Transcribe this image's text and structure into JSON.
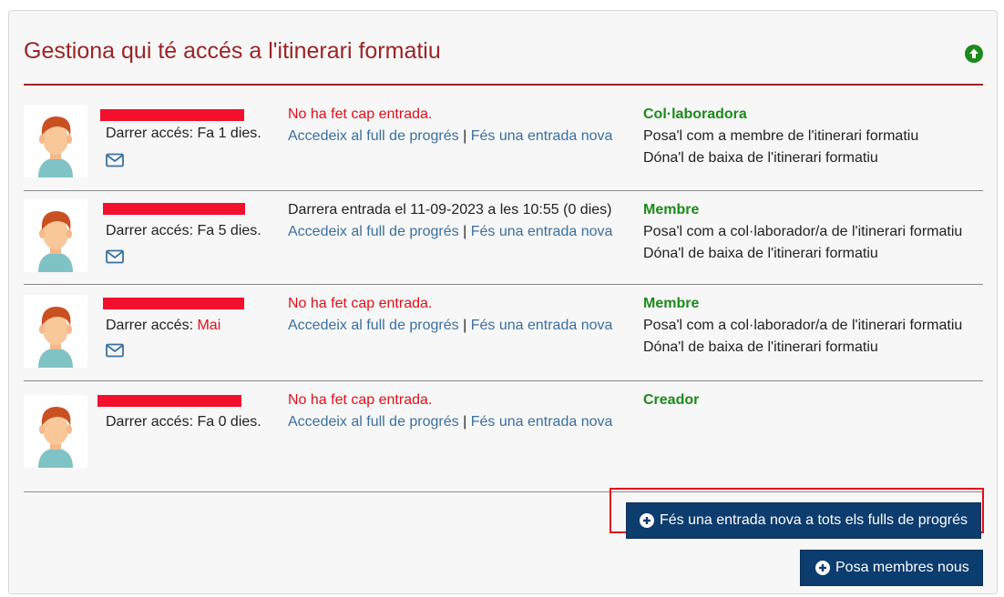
{
  "header": {
    "title": "Gestiona qui té accés a l'itinerari formatiu",
    "collapse_icon": "arrow-up-circle-icon"
  },
  "members": [
    {
      "access_label": "Darrer accés: ",
      "access_value": "Fa 1 dies.",
      "entry_status": "No ha fet cap entrada.",
      "progress_link": "Accedeix al full de progrés",
      "separator": "|",
      "new_entry_link": "Fés una entrada nova",
      "role": "Col·laboradora",
      "actions": [
        "Posa'l com a membre de l'itinerari formatiu",
        "Dóna'l de baixa de l'itinerari formatiu"
      ]
    },
    {
      "access_label": "Darrer accés: ",
      "access_value": "Fa 5 dies.",
      "entry_status": "Darrera entrada el 11-09-2023 a les 10:55 (0 dies)",
      "progress_link": "Accedeix al full de progrés",
      "separator": "|",
      "new_entry_link": "Fés una entrada nova",
      "role": "Membre",
      "actions": [
        "Posa'l com a col·laborador/a de l'itinerari formatiu",
        "Dóna'l de baixa de l'itinerari formatiu"
      ]
    },
    {
      "access_label": "Darrer accés: ",
      "access_value": "Mai",
      "entry_status": "No ha fet cap entrada.",
      "progress_link": "Accedeix al full de progrés",
      "separator": "|",
      "new_entry_link": "Fés una entrada nova",
      "role": "Membre",
      "actions": [
        "Posa'l com a col·laborador/a de l'itinerari formatiu",
        "Dóna'l de baixa de l'itinerari formatiu"
      ]
    },
    {
      "access_label": "Darrer accés: ",
      "access_value": "Fa 0 dies.",
      "entry_status": "No ha fet cap entrada.",
      "progress_link": "Accedeix al full de progrés",
      "separator": "|",
      "new_entry_link": "Fés una entrada nova",
      "role": "Creador",
      "actions": []
    }
  ],
  "buttons": {
    "bulk_entry": "Fés una entrada nova a tots els fulls de progrés",
    "add_members": "Posa membres nous"
  },
  "colors": {
    "title": "#9b2427",
    "role": "#1c8a1c",
    "link": "#3a70a0",
    "alert": "#e0101a",
    "button": "#0d3c6e",
    "redaction": "#f2102d"
  }
}
